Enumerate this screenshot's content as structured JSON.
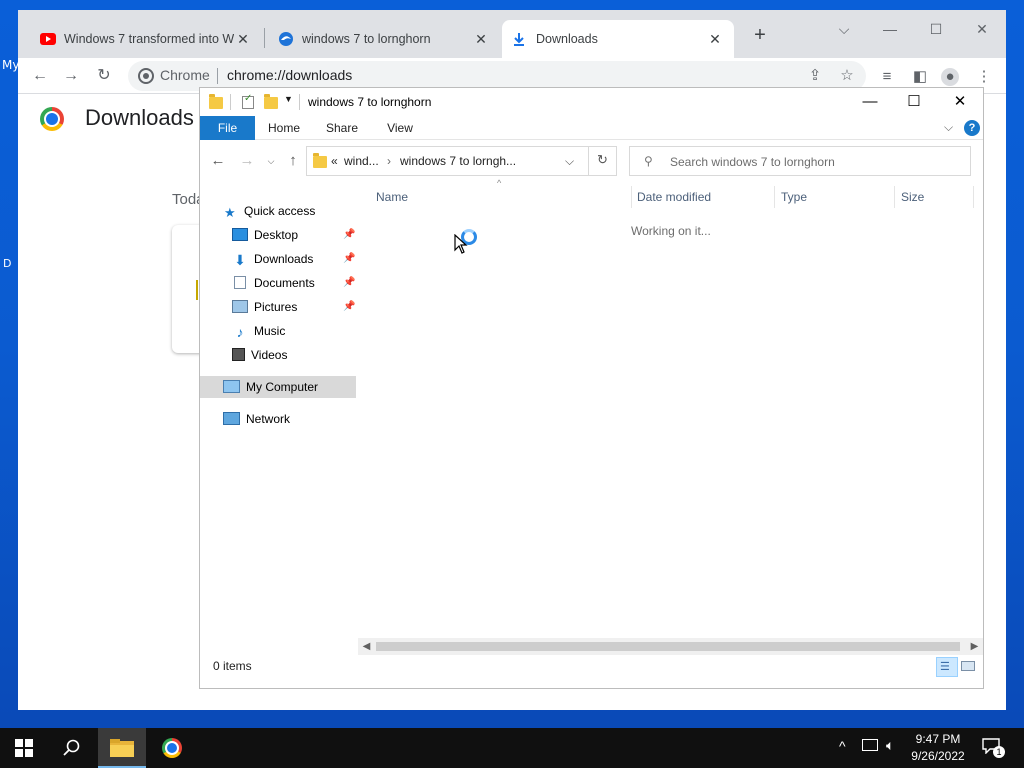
{
  "desktop": {
    "labels": [
      "My",
      "D"
    ]
  },
  "chrome": {
    "tabs": [
      {
        "title": "Windows 7 transformed into We",
        "icon": "youtube-icon"
      },
      {
        "title": "windows 7 to lornghorn",
        "icon": "edge-icon"
      },
      {
        "title": "Downloads",
        "icon": "download-icon"
      }
    ],
    "active_tab": 2,
    "omnibox": {
      "chip": "Chrome",
      "url": "chrome://downloads"
    },
    "page": {
      "title": "Downloads",
      "section": "Toda"
    }
  },
  "explorer": {
    "title": "windows 7 to lornghorn",
    "ribbon_tabs": [
      "File",
      "Home",
      "Share",
      "View"
    ],
    "address": {
      "overflow": "«",
      "crumb1": "wind...",
      "crumb2": "windows 7 to lorngh..."
    },
    "search_placeholder": "Search windows 7 to lornghorn",
    "nav": {
      "quick_access": "Quick access",
      "items": [
        {
          "label": "Desktop",
          "icon": "desktop-icon",
          "pinned": true
        },
        {
          "label": "Downloads",
          "icon": "downloads-icon",
          "pinned": true
        },
        {
          "label": "Documents",
          "icon": "documents-icon",
          "pinned": true
        },
        {
          "label": "Pictures",
          "icon": "pictures-icon",
          "pinned": true
        },
        {
          "label": "Music",
          "icon": "music-icon",
          "pinned": false
        },
        {
          "label": "Videos",
          "icon": "videos-icon",
          "pinned": false
        }
      ],
      "my_computer": "My Computer",
      "network": "Network"
    },
    "columns": [
      "Name",
      "Date modified",
      "Type",
      "Size"
    ],
    "status_message": "Working on it...",
    "item_count": "0 items"
  },
  "taskbar": {
    "time": "9:47 PM",
    "date": "9/26/2022",
    "notification_count": "1"
  },
  "colors": {
    "desktop": "#0a5fd8",
    "file_tab": "#1979ca",
    "taskbar": "#101010"
  }
}
